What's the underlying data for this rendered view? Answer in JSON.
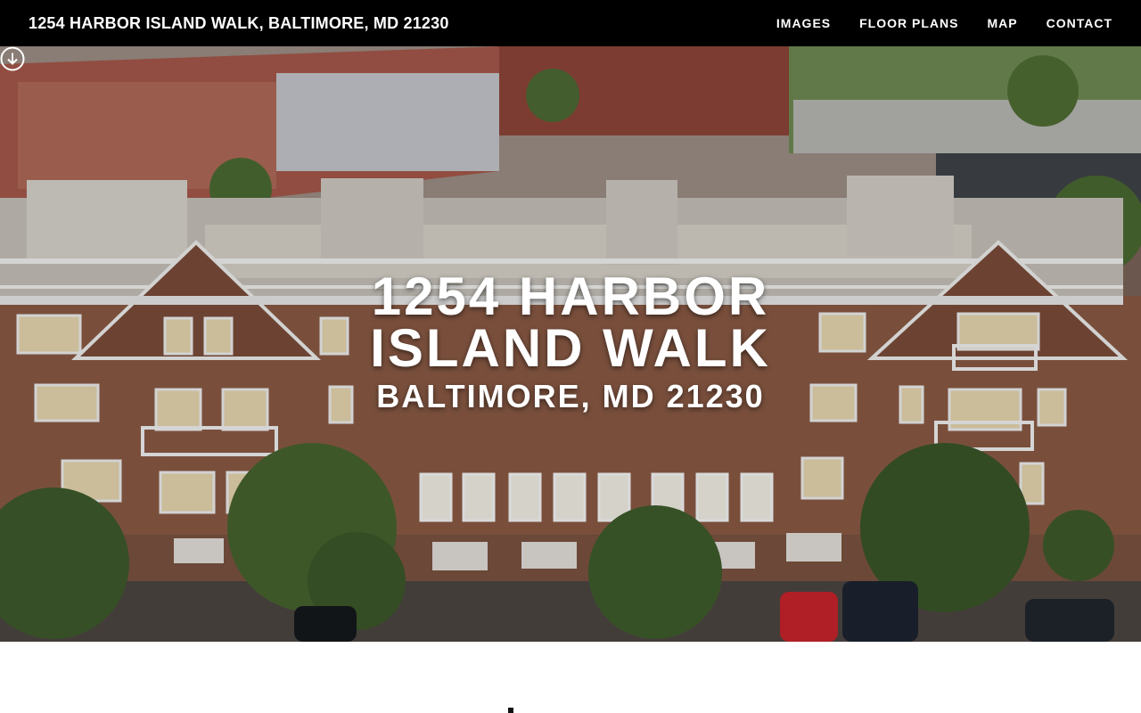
{
  "header": {
    "brand": "1254 HARBOR ISLAND WALK, BALTIMORE, MD 21230",
    "nav": [
      {
        "label": "IMAGES"
      },
      {
        "label": "FLOOR PLANS"
      },
      {
        "label": "MAP"
      },
      {
        "label": "CONTACT"
      }
    ]
  },
  "hero": {
    "title": "1254 HARBOR ISLAND WALK",
    "subtitle": "BALTIMORE, MD 21230",
    "scroll_icon": "arrow-down-circle-icon"
  },
  "colors": {
    "topbar": "#000000",
    "text": "#ffffff",
    "brick": "#8a5a45",
    "trim": "#e9e9e9"
  }
}
